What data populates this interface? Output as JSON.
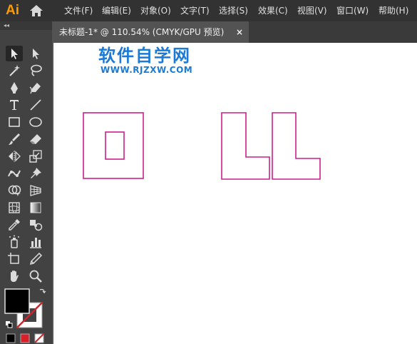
{
  "app": {
    "logo": "Ai"
  },
  "menu": [
    "文件(F)",
    "编辑(E)",
    "对象(O)",
    "文字(T)",
    "选择(S)",
    "效果(C)",
    "视图(V)",
    "窗口(W)",
    "帮助(H)"
  ],
  "panel": {
    "collapse_glyph": "◂◂"
  },
  "document_tab": {
    "label": "未标题-1* @ 110.54% (CMYK/GPU 预览)",
    "close_glyph": "×"
  },
  "watermark": {
    "title": "软件自学网",
    "url": "WWW.RJZXW.COM"
  },
  "colors": {
    "accent_logo": "#ff9a00",
    "watermark_blue": "#1a7ad6",
    "path_stroke": "#cc1f8a",
    "fill_swatch": "#000000",
    "stroke_none_red": "#d8202a"
  },
  "tools": [
    {
      "name": "selection-tool",
      "icon": "arrow-icon"
    },
    {
      "name": "direct-selection-tool",
      "icon": "white-arrow-icon"
    },
    {
      "name": "magic-wand-tool",
      "icon": "magic-wand-icon"
    },
    {
      "name": "lasso-tool",
      "icon": "lasso-icon"
    },
    {
      "name": "pen-tool",
      "icon": "pen-icon"
    },
    {
      "name": "curvature-tool",
      "icon": "curvature-pen-icon"
    },
    {
      "name": "type-tool",
      "icon": "type-icon"
    },
    {
      "name": "line-segment-tool",
      "icon": "line-icon"
    },
    {
      "name": "rectangle-tool",
      "icon": "rectangle-icon"
    },
    {
      "name": "ellipse-tool",
      "icon": "ellipse-icon"
    },
    {
      "name": "paintbrush-tool",
      "icon": "brush-icon"
    },
    {
      "name": "eraser-tool",
      "icon": "eraser-icon"
    },
    {
      "name": "reflect-tool",
      "icon": "reflect-icon"
    },
    {
      "name": "scale-tool",
      "icon": "scale-icon"
    },
    {
      "name": "puppet-warp-tool",
      "icon": "puppet-warp-icon"
    },
    {
      "name": "pin-tool",
      "icon": "pin-icon"
    },
    {
      "name": "shape-builder-tool",
      "icon": "shape-builder-icon"
    },
    {
      "name": "perspective-grid-tool",
      "icon": "perspective-grid-icon"
    },
    {
      "name": "mesh-tool",
      "icon": "mesh-icon"
    },
    {
      "name": "gradient-tool",
      "icon": "gradient-icon"
    },
    {
      "name": "eyedropper-tool",
      "icon": "eyedropper-icon"
    },
    {
      "name": "blend-tool",
      "icon": "blend-icon"
    },
    {
      "name": "symbol-sprayer-tool",
      "icon": "symbol-sprayer-icon"
    },
    {
      "name": "column-graph-tool",
      "icon": "bar-graph-icon"
    },
    {
      "name": "artboard-tool",
      "icon": "artboard-icon"
    },
    {
      "name": "slice-tool",
      "icon": "knife-icon"
    },
    {
      "name": "hand-tool",
      "icon": "hand-icon"
    },
    {
      "name": "zoom-tool",
      "icon": "magnifier-icon"
    }
  ]
}
